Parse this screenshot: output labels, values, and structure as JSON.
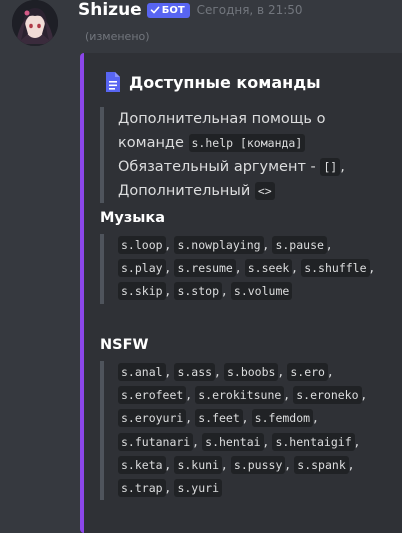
{
  "message": {
    "username": "Shizue",
    "bot_tag": "БОТ",
    "timestamp": "Сегодня, в 21:50",
    "edited": "(изменено)"
  },
  "embed": {
    "accent_color": "#8c47ea",
    "icon": "document-icon",
    "title": "Доступные команды",
    "description": {
      "line1": "Дополнительная помощь о",
      "line2_text": "команде",
      "help_code": "s.help [команда]",
      "line3_text": "Обязательный аргумент -",
      "required_code": "[]",
      "line3_suffix": ",",
      "line4_text": "Дополнительный",
      "optional_code": "<>"
    },
    "fields": [
      {
        "name": "Музыка",
        "commands": [
          "s.loop",
          "s.nowplaying",
          "s.pause",
          "s.play",
          "s.resume",
          "s.seek",
          "s.shuffle",
          "s.skip",
          "s.stop",
          "s.volume"
        ]
      },
      {
        "name": "NSFW",
        "commands": [
          "s.anal",
          "s.ass",
          "s.boobs",
          "s.ero",
          "s.erofeet",
          "s.erokitsune",
          "s.eroneko",
          "s.eroyuri",
          "s.feet",
          "s.femdom",
          "s.futanari",
          "s.hentai",
          "s.hentaigif",
          "s.keta",
          "s.kuni",
          "s.pussy",
          "s.spank",
          "s.trap",
          "s.yuri"
        ]
      }
    ]
  }
}
